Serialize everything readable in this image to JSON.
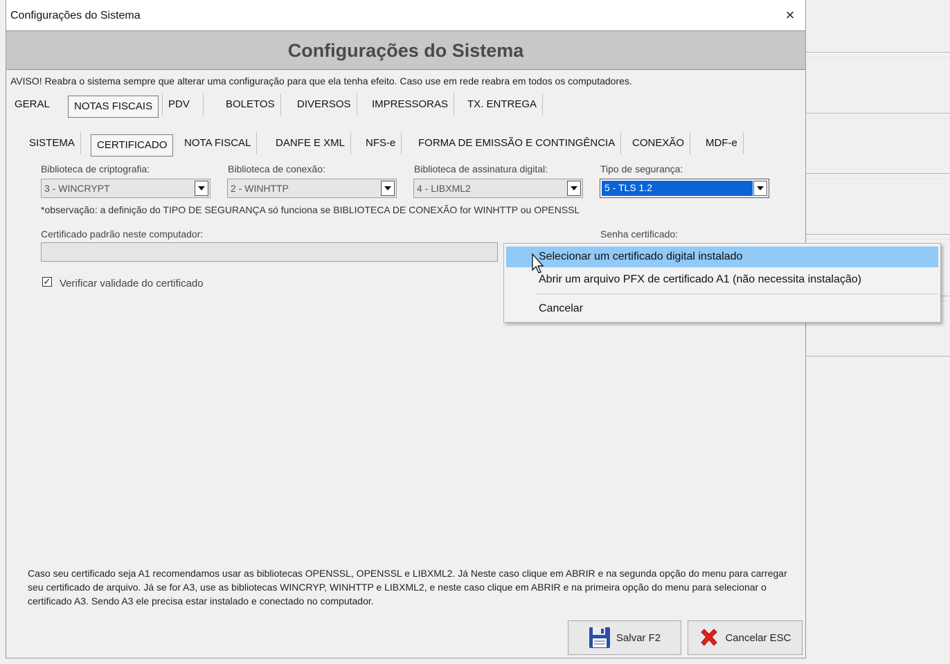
{
  "window": {
    "title": "Configurações do Sistema",
    "close_icon": "×"
  },
  "banner": {
    "title": "Configurações do Sistema"
  },
  "notice": "AVISO! Reabra o sistema sempre que alterar uma configuração para que ela tenha efeito. Caso use em rede reabra em todos os computadores.",
  "main_tabs": [
    "GERAL",
    "NOTAS FISCAIS",
    "PDV",
    "BOLETOS",
    "DIVERSOS",
    "IMPRESSORAS",
    "TX. ENTREGA"
  ],
  "main_tab_active": "NOTAS FISCAIS",
  "sub_tabs": [
    "SISTEMA",
    "CERTIFICADO",
    "NOTA FISCAL",
    "DANFE E XML",
    "NFS-e",
    "FORMA DE EMISSÃO E CONTINGÊNCIA",
    "CONEXÃO",
    "MDF-e"
  ],
  "sub_tab_active": "CERTIFICADO",
  "fields": {
    "crypto_lib": {
      "label": "Biblioteca de criptografia:",
      "value": "3 - WINCRYPT"
    },
    "conn_lib": {
      "label": "Biblioteca de conexão:",
      "value": "2 - WINHTTP"
    },
    "sign_lib": {
      "label": "Biblioteca de assinatura digital:",
      "value": "4 - LIBXML2"
    },
    "security_type": {
      "label": "Tipo de segurança:",
      "value": "5 - TLS 1.2"
    },
    "note": "*observação: a definição do TIPO DE SEGURANÇA só funciona se BIBLIOTECA DE CONEXÃO for WINHTTP ou OPENSSL",
    "default_cert": {
      "label": "Certificado padrão neste computador:",
      "value": ""
    },
    "cert_password": {
      "label": "Senha certificado:"
    },
    "verify_validity": {
      "label": "Verificar validade do certificado",
      "checked": true,
      "check_mark": "✓"
    }
  },
  "info_text": "Caso seu certificado seja A1 recomendamos usar as bibliotecas OPENSSL, OPENSSL e LIBXML2. Já Neste caso clique em ABRIR e na segunda opção do menu para carregar seu certificado de arquivo. Já se for A3, use as bibliotecas WINCRYP, WINHTTP e LIBXML2, e neste caso clique em ABRIR e na primeira opção do menu para selecionar o certificado A3. Sendo A3 ele precisa estar instalado e conectado no computador.",
  "buttons": {
    "save": {
      "label": "Salvar F2",
      "icon": "floppy-disk-icon"
    },
    "cancel": {
      "label": "Cancelar ESC",
      "icon": "red-x-icon"
    }
  },
  "context_menu": {
    "items": [
      "Selecionar um certificado digital instalado",
      "Abrir um arquivo PFX de certificado A1 (não necessita instalação)",
      "Cancelar"
    ],
    "highlighted_index": 0
  },
  "colors": {
    "banner_bg": "#c8c8c8",
    "selection_blue": "#0a64d8",
    "menu_highlight": "#91c9f7"
  }
}
